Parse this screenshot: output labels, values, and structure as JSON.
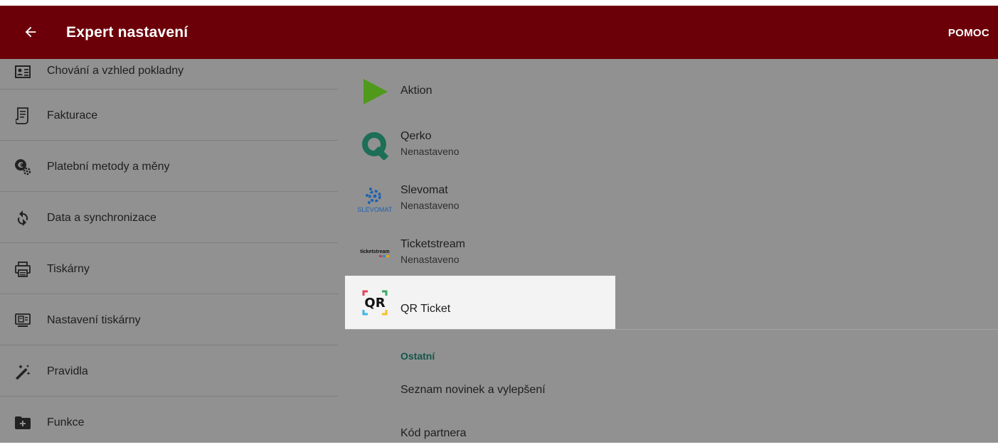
{
  "appbar": {
    "title": "Expert nastavení",
    "help_label": "POMOC",
    "background": "#6c0009"
  },
  "sidebar": {
    "items": [
      {
        "label": "Chování a vzhled pokladny",
        "icon": "contact-card-icon"
      },
      {
        "label": "Fakturace",
        "icon": "invoice-icon"
      },
      {
        "label": "Platební metody a měny",
        "icon": "payment-settings-icon"
      },
      {
        "label": "Data a synchronizace",
        "icon": "sync-icon"
      },
      {
        "label": "Tiskárny",
        "icon": "printer-icon"
      },
      {
        "label": "Nastavení tiskárny",
        "icon": "printer-settings-icon"
      },
      {
        "label": "Pravidla",
        "icon": "magic-wand-icon"
      },
      {
        "label": "Funkce",
        "icon": "folder-plus-icon"
      }
    ]
  },
  "integrations": [
    {
      "name": "Aktion",
      "status": "",
      "logo": "aktion-logo-icon",
      "logo_color": "#4f9a1a"
    },
    {
      "name": "Qerko",
      "status": "Nenastaveno",
      "logo": "qerko-logo-icon",
      "logo_color": "#1d6e56"
    },
    {
      "name": "Slevomat",
      "status": "Nenastaveno",
      "logo": "slevomat-logo-icon",
      "logo_text": "SLEVOMAT",
      "logo_color": "#1d62b1"
    },
    {
      "name": "Ticketstream",
      "status": "Nenastaveno",
      "logo": "ticketstream-logo-icon",
      "logo_text": "ticketstream"
    },
    {
      "name": "QR Ticket",
      "status": "",
      "logo": "qr-ticket-logo-icon",
      "logo_text": "QR"
    }
  ],
  "other": {
    "header": "Ostatní",
    "items": [
      "Seznam novinek a vylepšení",
      "Kód partnera"
    ]
  },
  "colors": {
    "overlay": "#919191",
    "highlight": "#f3f3f3",
    "section_header": "#14564a"
  }
}
